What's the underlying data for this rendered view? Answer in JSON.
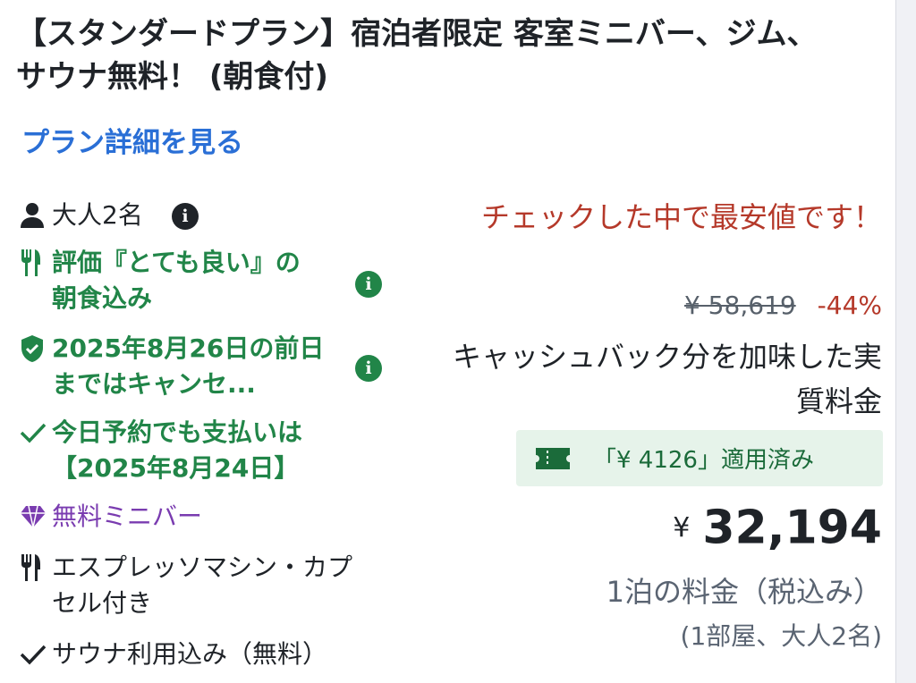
{
  "plan": {
    "title": "【スタンダードプラン】宿泊者限定 客室ミニバー、ジム、サウナ無料！ (朝食付)",
    "details_link": "プラン詳細を見る"
  },
  "features": [
    {
      "icon": "person-icon",
      "text": "大人2名",
      "style": "normal",
      "info": true
    },
    {
      "icon": "cutlery-icon",
      "text": "評価『とても良い』の朝食込み",
      "style": "green",
      "info": true
    },
    {
      "icon": "shield-check-icon",
      "text": "2025年8月26日の前日まではキャンセ...",
      "style": "green",
      "info": true
    },
    {
      "icon": "checkmark-icon",
      "text": "今日予約でも支払いは【2025年8月24日】",
      "style": "green",
      "info": false
    },
    {
      "icon": "diamond-icon",
      "text": "無料ミニバー",
      "style": "purple",
      "info": false
    },
    {
      "icon": "cutlery-icon",
      "text": "エスプレッソマシン・カプセル付き",
      "style": "normal",
      "info": false
    },
    {
      "icon": "checkmark-icon",
      "text": "サウナ利用込み（無料）",
      "style": "normal",
      "info": false
    }
  ],
  "pricing": {
    "cheapest_note": "チェックした中で最安値です！",
    "original_price": "¥ 58,619",
    "discount": "-44%",
    "cashback_note": "キャッシュバック分を加味した実質料金",
    "cashback_badge": "「¥ 4126」適用済み",
    "currency": "¥",
    "price": "32,194",
    "per_night": "1泊の料金（税込み）",
    "occupancy": "(1部屋、大人2名)"
  },
  "colors": {
    "link": "#2a6fd6",
    "green": "#218548",
    "red": "#b5392a",
    "purple": "#7a3cb0",
    "badge_bg": "#e6f3ea"
  }
}
